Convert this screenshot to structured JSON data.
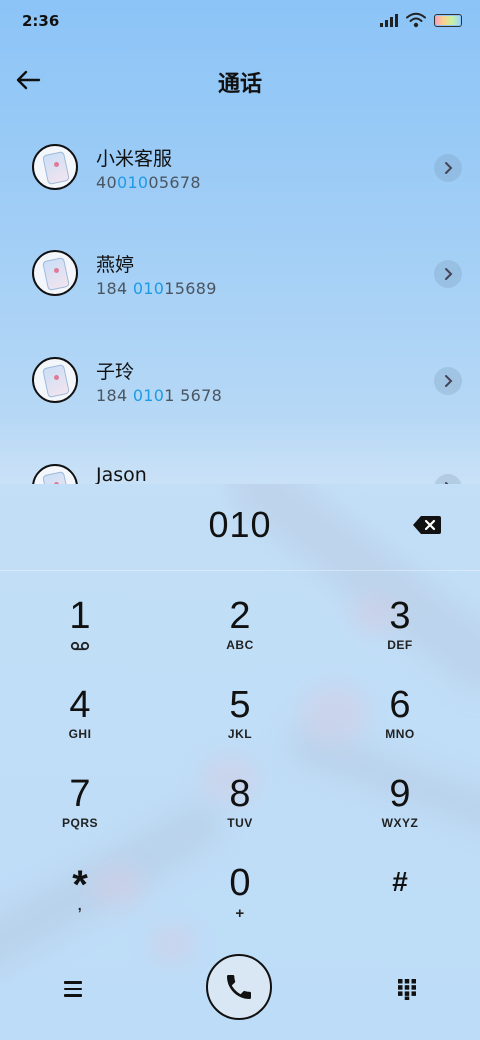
{
  "status_bar": {
    "time": "2:36"
  },
  "header": {
    "title": "通话"
  },
  "contacts": [
    {
      "name": "小米客服",
      "number_pre": "40",
      "number_match": "010",
      "number_post": "05678"
    },
    {
      "name": "燕婷",
      "number_pre": "184 ",
      "number_match": "010",
      "number_post": "15689"
    },
    {
      "name": "子玲",
      "number_pre": "184 ",
      "number_match": "010",
      "number_post": "1 5678"
    },
    {
      "name": "Jason",
      "number_pre": "",
      "number_match": "",
      "number_post": ""
    }
  ],
  "dialer": {
    "input": "010",
    "keys": [
      {
        "digit": "1",
        "letters": ""
      },
      {
        "digit": "2",
        "letters": "ABC"
      },
      {
        "digit": "3",
        "letters": "DEF"
      },
      {
        "digit": "4",
        "letters": "GHI"
      },
      {
        "digit": "5",
        "letters": "JKL"
      },
      {
        "digit": "6",
        "letters": "MNO"
      },
      {
        "digit": "7",
        "letters": "PQRS"
      },
      {
        "digit": "8",
        "letters": "TUV"
      },
      {
        "digit": "9",
        "letters": "WXYZ"
      },
      {
        "digit": "*",
        "letters": ","
      },
      {
        "digit": "0",
        "letters": "+"
      },
      {
        "digit": "#",
        "letters": ""
      }
    ]
  },
  "icons": {
    "back": "back-arrow-icon",
    "chevron": "chevron-right-icon",
    "backspace": "backspace-icon",
    "voicemail": "voicemail-icon",
    "menu": "menu-icon",
    "call": "phone-icon",
    "keypad": "keypad-icon"
  },
  "colors": {
    "match_highlight": "#1e9be5"
  }
}
